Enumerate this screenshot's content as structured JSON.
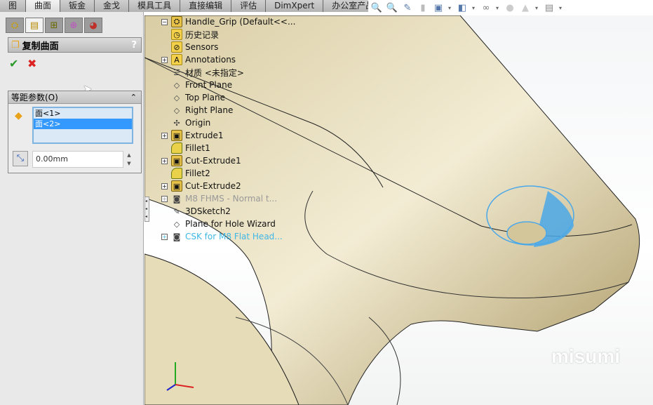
{
  "command_tabs": [
    {
      "label": "图"
    },
    {
      "label": "曲面",
      "active": true
    },
    {
      "label": "钣金"
    },
    {
      "label": "金戈"
    },
    {
      "label": "模具工具"
    },
    {
      "label": "直接编辑"
    },
    {
      "label": "评估"
    },
    {
      "label": "DimXpert"
    },
    {
      "label": "办公室产品"
    }
  ],
  "toolbar_icons": [
    "zoom-to-fit-icon",
    "zoom-to-area-icon",
    "previous-view-icon",
    "section-view-icon",
    "view-orientation-icon",
    "display-style-icon",
    "hide-show-items-icon",
    "edit-appearance-icon",
    "apply-scene-icon",
    "view-settings-icon"
  ],
  "property_manager": {
    "title": "复制曲面",
    "help": "?",
    "ok_icon": "checkmark-icon",
    "cancel_icon": "x-icon",
    "group": {
      "title": "等距参数(O)",
      "faces": [
        {
          "label": "面<1>",
          "selected": false
        },
        {
          "label": "面<2>",
          "selected": true
        }
      ],
      "distance": "0.00mm"
    }
  },
  "feature_tree": {
    "root": "Handle_Grip  (Default<<...",
    "items": [
      {
        "label": "历史记录",
        "icon": "history-icon"
      },
      {
        "label": "Sensors",
        "icon": "sensors-icon"
      },
      {
        "label": "Annotations",
        "icon": "annotations-icon",
        "expandable": true
      },
      {
        "label": "材质 <未指定>",
        "icon": "material-icon"
      },
      {
        "label": "Front Plane",
        "icon": "plane-icon"
      },
      {
        "label": "Top Plane",
        "icon": "plane-icon"
      },
      {
        "label": "Right Plane",
        "icon": "plane-icon"
      },
      {
        "label": "Origin",
        "icon": "origin-icon"
      },
      {
        "label": "Extrude1",
        "icon": "extrude-icon",
        "expandable": true
      },
      {
        "label": "Fillet1",
        "icon": "fillet-icon"
      },
      {
        "label": "Cut-Extrude1",
        "icon": "cut-extrude-icon",
        "expandable": true
      },
      {
        "label": "Fillet2",
        "icon": "fillet-icon"
      },
      {
        "label": "Cut-Extrude2",
        "icon": "cut-extrude-icon",
        "expandable": true
      },
      {
        "label": "M8 FHMS - Normal t...",
        "icon": "hole-wizard-icon",
        "expandable": true,
        "state": "suppressed"
      },
      {
        "label": "3DSketch2",
        "icon": "3dsketch-icon"
      },
      {
        "label": "Plane for Hole Wizard",
        "icon": "plane-icon"
      },
      {
        "label": "CSK for M8 Flat Head...",
        "icon": "hole-wizard-icon",
        "expandable": true,
        "state": "selected"
      }
    ]
  },
  "watermark": "misumi",
  "colors": {
    "model": "#e3d9b4",
    "selected_face": "#4aa8e8",
    "selection_highlight": "#3399ff"
  }
}
